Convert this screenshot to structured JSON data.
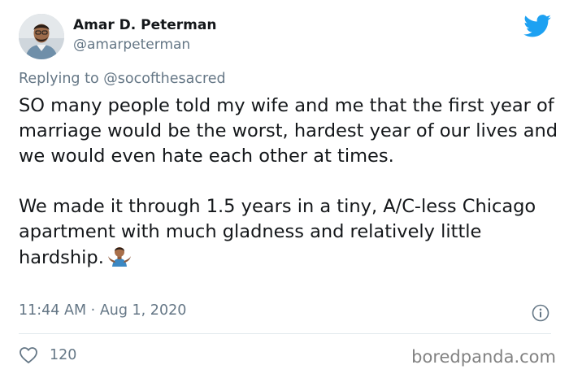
{
  "author": {
    "name": "Amar D. Peterman",
    "handle": "@amarpeterman",
    "avatar_icon": "person-avatar"
  },
  "reply": {
    "prefix": "Replying to",
    "handle": "@socofthesacred"
  },
  "tweet": {
    "paragraph_1": "SO many people told my wife and me that the first year of marriage would be the worst, hardest year of our lives and we would even hate each other at times.",
    "paragraph_2": "We made it through 1.5 years in a tiny, A/C-less Chicago apartment with much gladness and relatively little hardship.",
    "emoji": "person-shrugging-emoji"
  },
  "meta": {
    "time": "11:44 AM",
    "separator": "·",
    "date": "Aug 1, 2020"
  },
  "actions": {
    "like_count": "120"
  },
  "watermark": "boredpanda.com",
  "colors": {
    "twitter_blue": "#1da1f2",
    "secondary_text": "#657786",
    "primary_text": "#14171a"
  }
}
